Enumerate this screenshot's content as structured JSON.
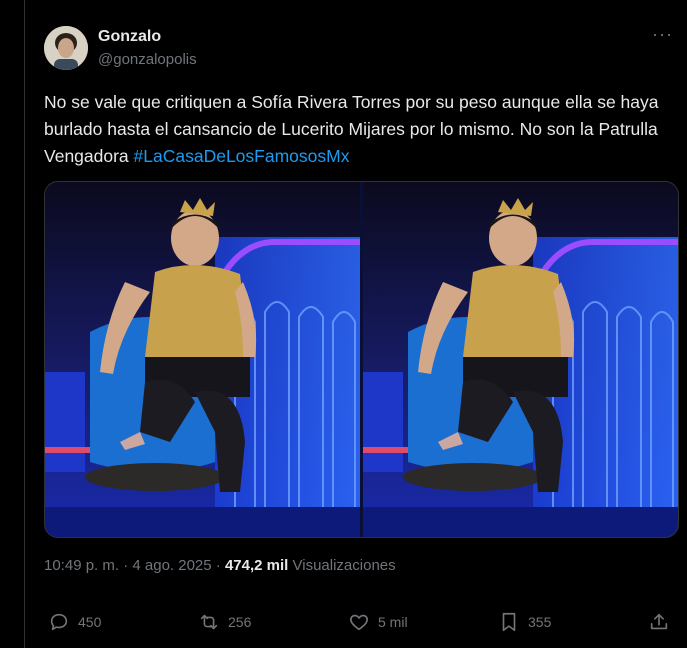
{
  "author": {
    "name": "Gonzalo",
    "handle": "@gonzalopolis"
  },
  "tweet": {
    "text_before": "No se vale que critiquen a Sofía Rivera Torres por su peso aunque ella se haya burlado hasta el cansancio de Lucerito Mijares por lo mismo. No son la Patrulla Vengadora ",
    "hashtag": "#LaCasaDeLosFamososMx"
  },
  "meta": {
    "datetime": "10:49 p. m. · 4 ago. 2025 · ",
    "views_count": "474,2 mil",
    "views_label": " Visualizaciones"
  },
  "actions": {
    "replies": "450",
    "reposts": "256",
    "likes": "5 mil",
    "bookmarks": "355"
  },
  "colors": {
    "background": "#000000",
    "text": "#e7e9ea",
    "secondary": "#71767b",
    "link": "#1d9bf0"
  }
}
